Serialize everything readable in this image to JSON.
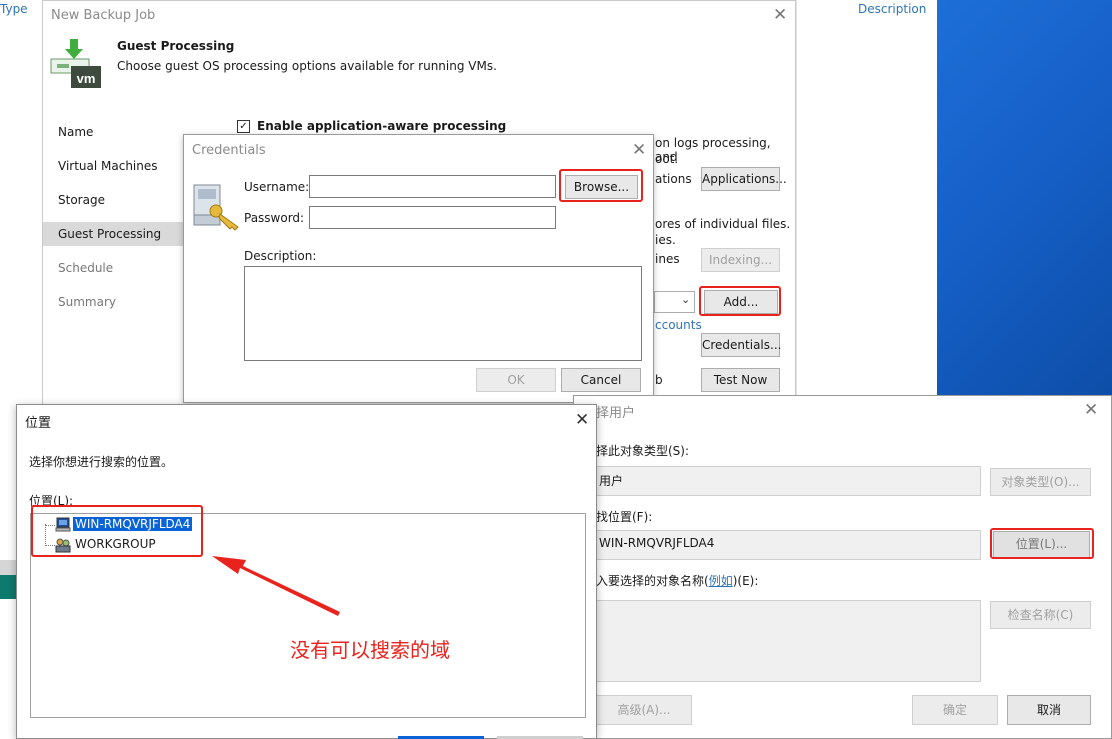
{
  "background": {
    "type_label": "Type",
    "description_label": "Description",
    "desktop_color": "#1660c8"
  },
  "wizard": {
    "title": "New Backup Job",
    "close": "✕",
    "icon_label": "vm",
    "heading": "Guest Processing",
    "subheading": "Choose guest OS processing options available for running VMs.",
    "nav": [
      "Name",
      "Virtual Machines",
      "Storage",
      "Guest Processing",
      "Schedule",
      "Summary"
    ],
    "enable_app_aware": "Enable application-aware processing",
    "text_logs": "on logs processing, and",
    "text_boot": "oot.",
    "text_ations": "ations",
    "text_stores": "ores of individual files.",
    "text_ies": "ies.",
    "text_ines": "ines",
    "text_accounts": "ccounts",
    "text_b": "b",
    "applications_button": "Applications...",
    "indexing_button": "Indexing...",
    "add_button": "Add...",
    "credentials_button": "Credentials...",
    "test_now_button": "Test Now"
  },
  "credentials": {
    "title": "Credentials",
    "close": "✕",
    "username_label": "Username:",
    "username_value": "",
    "password_label": "Password:",
    "password_value": "",
    "browse_button": "Browse...",
    "description_label": "Description:",
    "description_value": "",
    "ok_button": "OK",
    "cancel_button": "Cancel"
  },
  "select_user": {
    "title": "择用户",
    "close": "✕",
    "object_type_label": "择此对象类型(S):",
    "object_type_value": "用户",
    "object_types_button": "对象类型(O)...",
    "location_label": "找位置(F):",
    "location_value": "WIN-RMQVRJFLDA4",
    "locations_button": "位置(L)...",
    "names_label_prefix": "入要选择的对象名称(",
    "names_label_link": "例如",
    "names_label_suffix": ")(E):",
    "check_names_button": "检查名称(C)",
    "advanced_button": "高级(A)...",
    "ok_button": "确定",
    "cancel_button": "取消"
  },
  "location_dialog": {
    "title": "位置",
    "close": "✕",
    "prompt": "选择你想进行搜索的位置。",
    "location_label": "位置(L):",
    "tree_items": [
      "WIN-RMQVRJFLDA4",
      "WORKGROUP"
    ]
  },
  "annotation": {
    "text": "没有可以搜索的域",
    "color": "#e8231d"
  }
}
